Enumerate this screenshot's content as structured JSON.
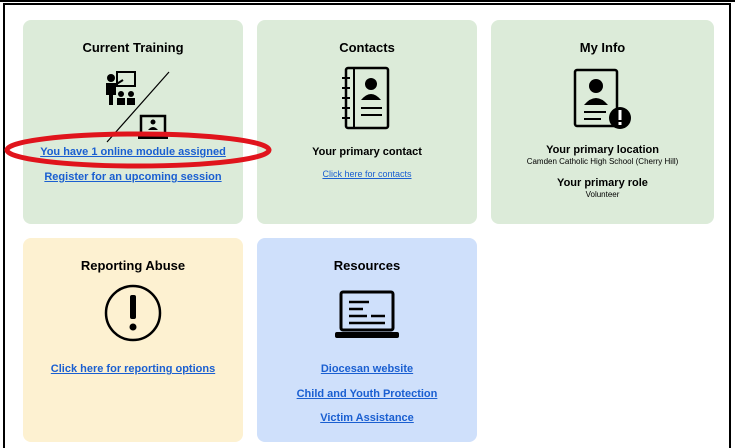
{
  "current_training": {
    "title": "Current Training",
    "icon": "teacher-and-laptop-icon",
    "module_link": "You have 1 online module assigned",
    "register_link": "Register for an upcoming session"
  },
  "contacts": {
    "title": "Contacts",
    "icon": "address-book-icon",
    "primary_label": "Your primary contact",
    "contacts_link": "Click here for contacts"
  },
  "my_info": {
    "title": "My Info",
    "icon": "user-profile-alert-icon",
    "location_label": "Your primary location",
    "location_value": "Camden Catholic High School (Cherry Hill)",
    "role_label": "Your primary role",
    "role_value": "Volunteer"
  },
  "reporting_abuse": {
    "title": "Reporting Abuse",
    "icon": "exclamation-circle-icon",
    "options_link": "Click here for reporting options"
  },
  "resources": {
    "title": "Resources",
    "icon": "laptop-document-icon",
    "links": [
      "Diocesan website",
      "Child and Youth Protection",
      "Victim Assistance"
    ]
  },
  "annotation": {
    "color": "#e0141c"
  },
  "colors": {
    "green_card": "#dcebd9",
    "yellow_card": "#fdf1d1",
    "blue_card": "#cfe0fb",
    "link": "#1a5fd1"
  }
}
